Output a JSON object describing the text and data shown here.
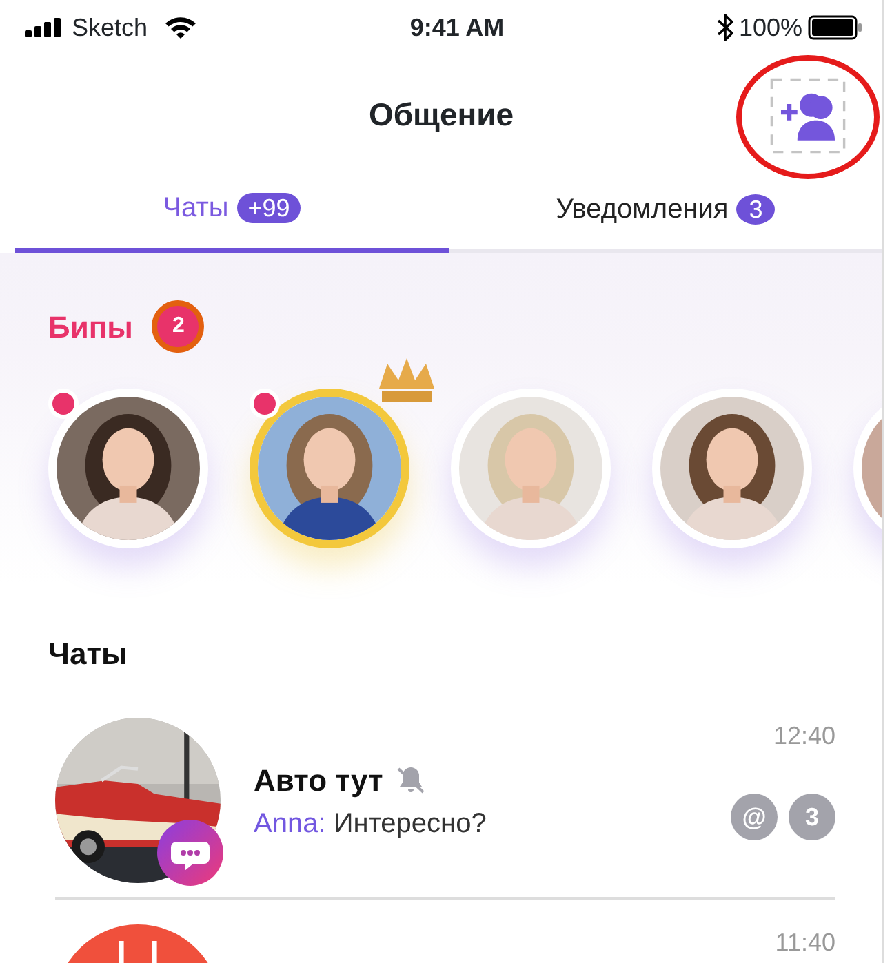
{
  "status_bar": {
    "carrier": "Sketch",
    "time": "9:41 AM",
    "battery": "100%"
  },
  "header": {
    "title": "Общение"
  },
  "tabs": [
    {
      "label": "Чаты",
      "badge": "+99",
      "selected": true
    },
    {
      "label": "Уведомления",
      "badge": "3",
      "selected": false
    }
  ],
  "beeps": {
    "title": "Бипы",
    "badge": "2",
    "stories": [
      {
        "kind": "picture",
        "unread": true,
        "crowned": false
      },
      {
        "kind": "picture",
        "unread": true,
        "crowned": true
      },
      {
        "kind": "picture",
        "unread": false,
        "crowned": false
      },
      {
        "kind": "picture",
        "unread": false,
        "crowned": false
      },
      {
        "kind": "picture",
        "unread": false,
        "crowned": false
      }
    ]
  },
  "chats_heading": "Чаты",
  "chats": [
    {
      "name": "Авто тут",
      "muted": true,
      "sender": "Anna:",
      "message": "Интересно?",
      "time": "12:40",
      "mention": "@",
      "unread": "3",
      "group": true
    },
    {
      "time": "11:40",
      "group": false
    }
  ]
}
